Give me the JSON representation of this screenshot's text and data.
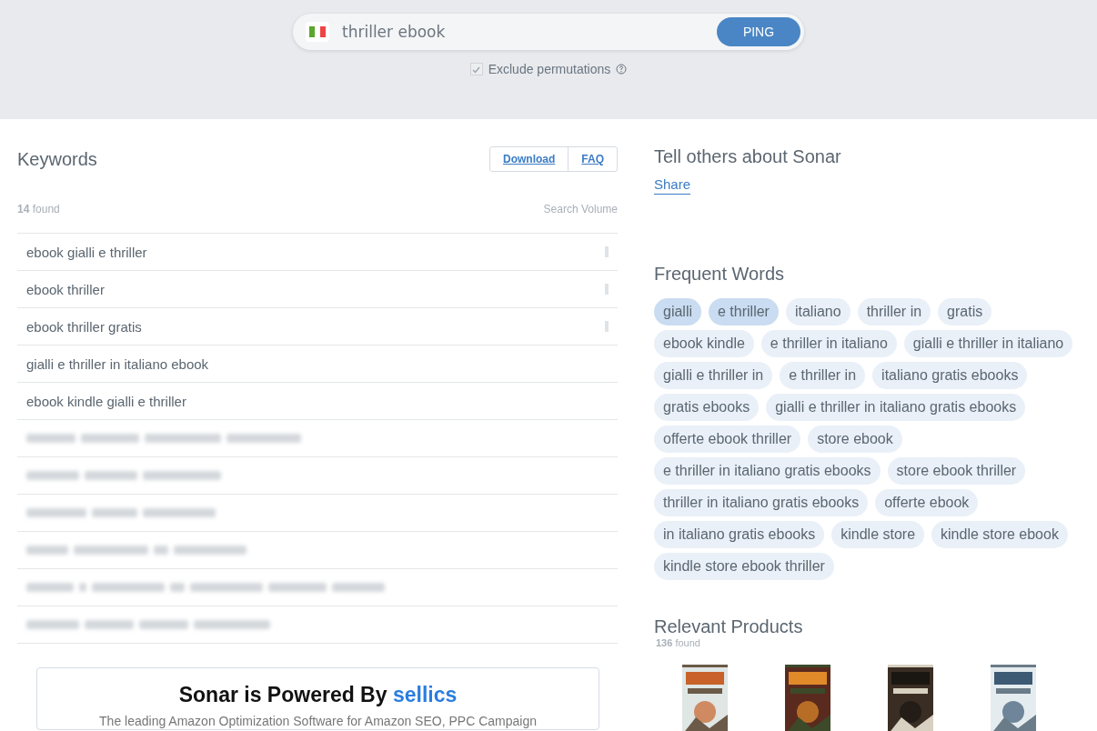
{
  "search": {
    "value": "thriller ebook",
    "button": "PING",
    "exclude": {
      "label": "Exclude permutations",
      "checked": true
    }
  },
  "keywords": {
    "title": "Keywords",
    "actions": [
      "Download",
      "FAQ"
    ],
    "count": "14",
    "count_label": "found",
    "volume_header": "Search Volume",
    "rows": [
      {
        "kind": "keyword",
        "text": "ebook gialli e thriller",
        "has_volume": true
      },
      {
        "kind": "keyword",
        "text": "ebook thriller",
        "has_volume": true
      },
      {
        "kind": "keyword",
        "text": "ebook thriller gratis",
        "has_volume": true
      },
      {
        "kind": "keyword",
        "text": "gialli e thriller in italiano ebook",
        "has_volume": false
      },
      {
        "kind": "keyword",
        "text": "ebook kindle gialli e thriller",
        "has_volume": false
      },
      {
        "kind": "blurred"
      },
      {
        "kind": "blurred"
      },
      {
        "kind": "blurred"
      },
      {
        "kind": "blurred"
      },
      {
        "kind": "blurred"
      },
      {
        "kind": "blurred"
      }
    ]
  },
  "promo": {
    "title_prefix": "Sonar is Powered By",
    "brand": "sellics",
    "text": "The leading Amazon Optimization Software for Amazon SEO, PPC Campaign"
  },
  "share": {
    "title": "Tell others about Sonar",
    "link": "Share"
  },
  "frequent_words": {
    "title": "Frequent Words",
    "chips": [
      {
        "text": "gialli",
        "selected": true
      },
      {
        "text": "e thriller",
        "selected": true
      },
      {
        "text": "italiano",
        "selected": false
      },
      {
        "text": "thriller in",
        "selected": false
      },
      {
        "text": "gratis",
        "selected": false
      },
      {
        "text": "ebook kindle",
        "selected": false
      },
      {
        "text": "e thriller in italiano",
        "selected": false
      },
      {
        "text": "gialli e thriller in italiano",
        "selected": false
      },
      {
        "text": "gialli e thriller in",
        "selected": false
      },
      {
        "text": "e thriller in",
        "selected": false
      },
      {
        "text": "italiano gratis ebooks",
        "selected": false
      },
      {
        "text": "gratis ebooks",
        "selected": false
      },
      {
        "text": "gialli e thriller in italiano gratis ebooks",
        "selected": false
      },
      {
        "text": "offerte ebook thriller",
        "selected": false
      },
      {
        "text": "store ebook",
        "selected": false
      },
      {
        "text": "e thriller in italiano gratis ebooks",
        "selected": false
      },
      {
        "text": "store ebook thriller",
        "selected": false
      },
      {
        "text": "thriller in italiano gratis ebooks",
        "selected": false
      },
      {
        "text": "offerte ebook",
        "selected": false
      },
      {
        "text": "in italiano gratis ebooks",
        "selected": false
      },
      {
        "text": "kindle store",
        "selected": false
      },
      {
        "text": "kindle store ebook",
        "selected": false
      },
      {
        "text": "kindle store ebook thriller",
        "selected": false
      }
    ]
  },
  "products": {
    "title": "Relevant Products",
    "count": "136",
    "count_label": "found"
  }
}
